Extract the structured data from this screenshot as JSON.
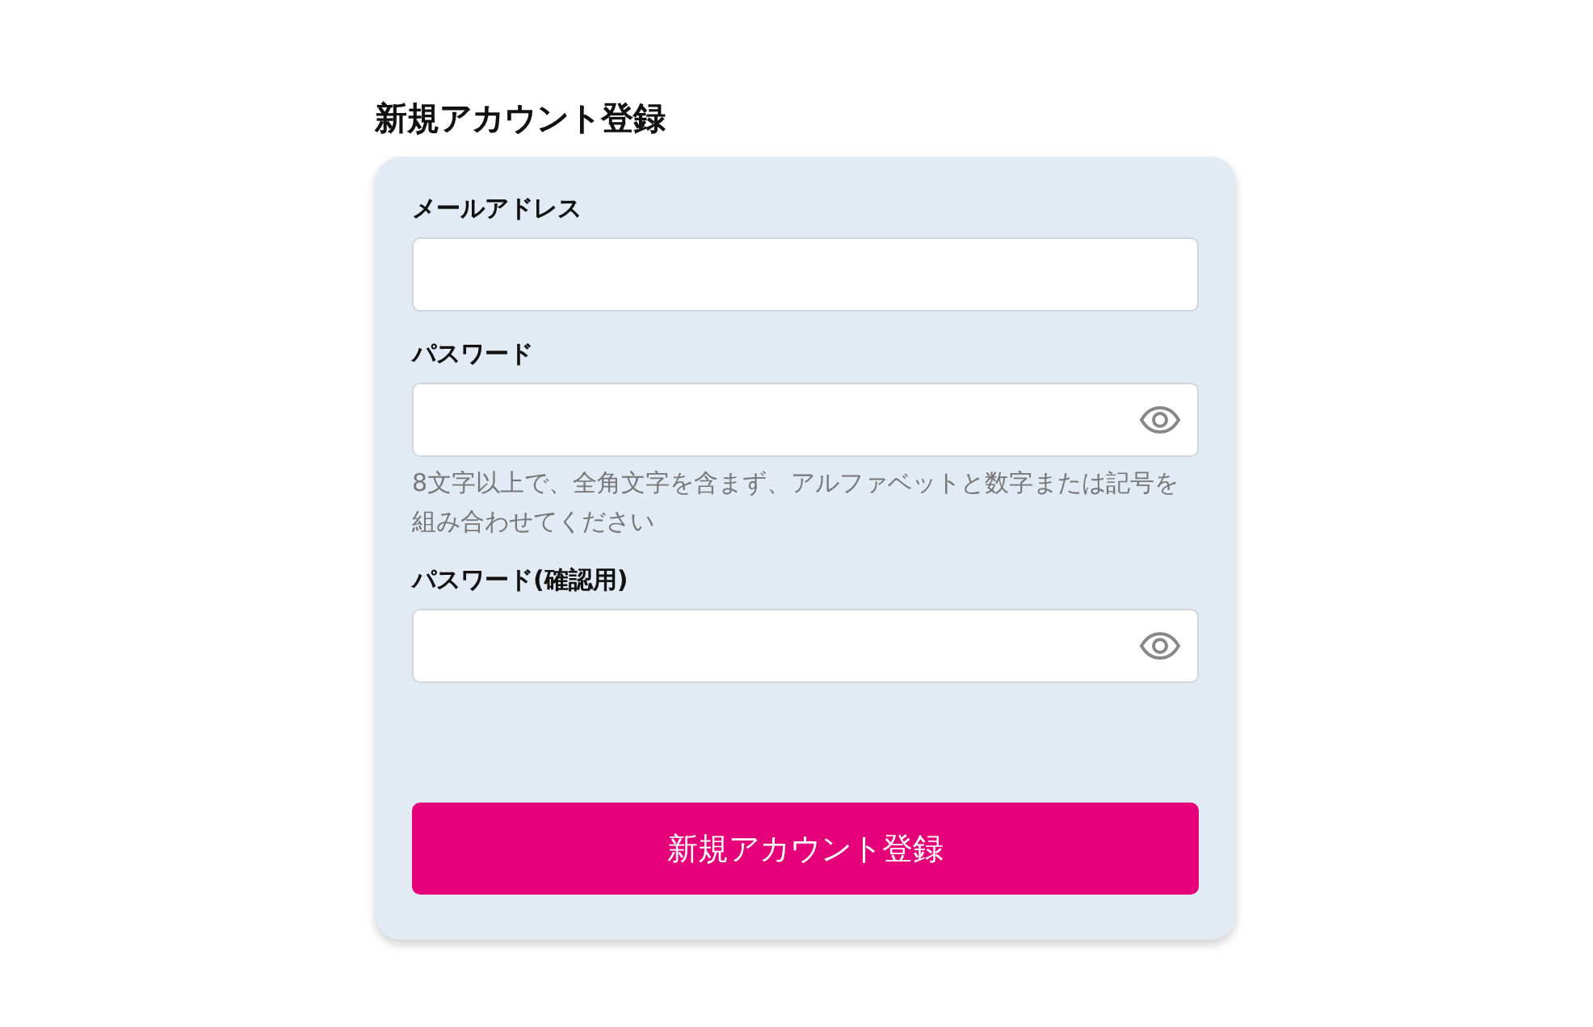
{
  "title": "新規アカウント登録",
  "fields": [
    {
      "label": "メールアドレス",
      "kind": "text"
    },
    {
      "label": "パスワード",
      "kind": "password",
      "hint": "8文字以上で、全角文字を含まず、アルファベットと数字または記号を組み合わせてください"
    },
    {
      "label": "パスワード(確認用)",
      "kind": "password"
    }
  ],
  "submit": "新規アカウント登録"
}
